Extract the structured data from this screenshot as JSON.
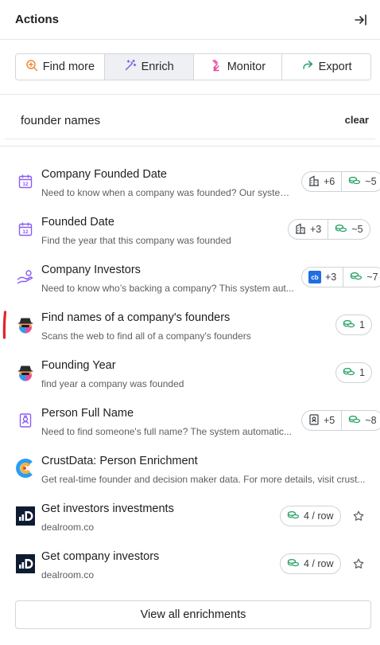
{
  "header": {
    "title": "Actions",
    "collapse_icon": "collapse-right-icon"
  },
  "tabs": [
    {
      "label": "Find more",
      "icon": "search-plus-icon",
      "color": "#f08a3c"
    },
    {
      "label": "Enrich",
      "icon": "magic-wand-icon",
      "color": "#7c5cf0",
      "active": true
    },
    {
      "label": "Monitor",
      "icon": "radar-icon",
      "color": "#e84ba0"
    },
    {
      "label": "Export",
      "icon": "share-arrow-icon",
      "color": "#2ba36b"
    }
  ],
  "search": {
    "value": "founder names",
    "clear_label": "clear"
  },
  "items": [
    {
      "name": "Company Founded Date",
      "desc": "Need to know when a company was founded? Our system...",
      "icon": "calendar-12-icon",
      "pill": [
        "+6",
        "~5"
      ],
      "pill_lead_icon": "building-icon"
    },
    {
      "name": "Founded Date",
      "desc": "Find the year that this company was founded",
      "icon": "calendar-12-icon",
      "pill": [
        "+3",
        "~5"
      ],
      "pill_lead_icon": "building-icon"
    },
    {
      "name": "Company Investors",
      "desc": "Need to know who’s backing a company? This system aut...",
      "icon": "hand-coins-icon",
      "pill": [
        "+3",
        "~7"
      ],
      "pill_lead_icon": "crunchbase-icon",
      "pill_lead_text": "cb"
    },
    {
      "name": "Find names of a company's founders",
      "desc": "Scans the web to find all of a company's founders",
      "icon": "spy-agent-icon",
      "pill": [
        "1"
      ]
    },
    {
      "name": "Founding Year",
      "desc": "find year a company was founded",
      "icon": "spy-agent-icon",
      "pill": [
        "1"
      ]
    },
    {
      "name": "Person Full Name",
      "desc": "Need to find someone's full name? The system automatic...",
      "icon": "id-badge-icon",
      "pill": [
        "+5",
        "~8"
      ],
      "pill_lead_icon": "id-badge-icon"
    },
    {
      "name": "CrustData: Person Enrichment",
      "desc": "Get real-time founder and decision maker data. For more details, visit crust...",
      "icon": "crustdata-logo-icon"
    },
    {
      "name": "Get investors investments",
      "desc": "dealroom.co",
      "icon": "dealroom-logo-icon",
      "pill": [
        "4 / row"
      ],
      "star": true
    },
    {
      "name": "Get company investors",
      "desc": "dealroom.co",
      "icon": "dealroom-logo-icon",
      "pill": [
        "4 / row"
      ],
      "star": true
    }
  ],
  "view_all_label": "View all enrichments",
  "colors": {
    "accent_purple": "#7c5cf0",
    "credit_green": "#2ba36b",
    "marker_red": "#e0242b"
  }
}
